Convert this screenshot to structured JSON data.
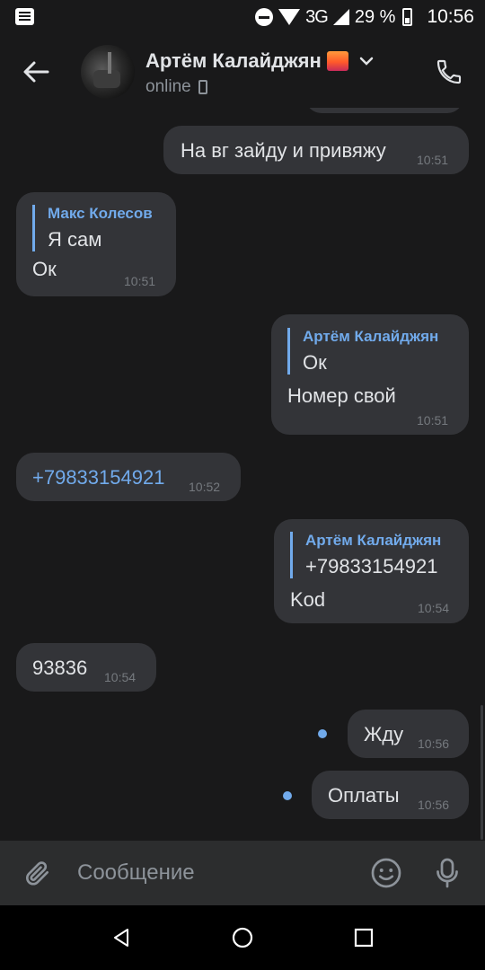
{
  "statusbar": {
    "network": "3G",
    "battery": "29 %",
    "time": "10:56"
  },
  "header": {
    "name": "Артём Калайджян",
    "status": "online"
  },
  "messages": [
    {
      "side": "out",
      "text": "На вг зайду и привяжу",
      "time": "10:51"
    },
    {
      "side": "in",
      "quote_name": "Макс Колесов",
      "quote_text": "Я сам",
      "text": "Ок",
      "time": "10:51"
    },
    {
      "side": "out",
      "quote_name": "Артём Калайджян",
      "quote_text": "Ок",
      "text": "Номер свой",
      "time": "10:51"
    },
    {
      "side": "in",
      "text": "+79833154921",
      "time": "10:52",
      "is_link": true
    },
    {
      "side": "out",
      "quote_name": "Артём Калайджян",
      "quote_text": "+79833154921",
      "text": "Kod",
      "time": "10:54"
    },
    {
      "side": "in",
      "text": "93836",
      "time": "10:54"
    },
    {
      "side": "out",
      "text": "Жду",
      "time": "10:56",
      "unread": true
    },
    {
      "side": "out",
      "text": "Оплаты",
      "time": "10:56",
      "unread": true
    }
  ],
  "composer": {
    "placeholder": "Сообщение"
  },
  "colors": {
    "background": "#19191a",
    "bubble": "#333438",
    "accent": "#71aaeb",
    "composer": "#2c2d2e"
  },
  "icons": [
    "notification-icon",
    "do-not-disturb-icon",
    "wifi-icon",
    "signal-icon",
    "battery-icon",
    "back-arrow-icon",
    "chevron-down-icon",
    "mobile-device-icon",
    "phone-icon",
    "attach-icon",
    "emoji-icon",
    "microphone-icon",
    "nav-back-icon",
    "nav-home-icon",
    "nav-recents-icon"
  ]
}
